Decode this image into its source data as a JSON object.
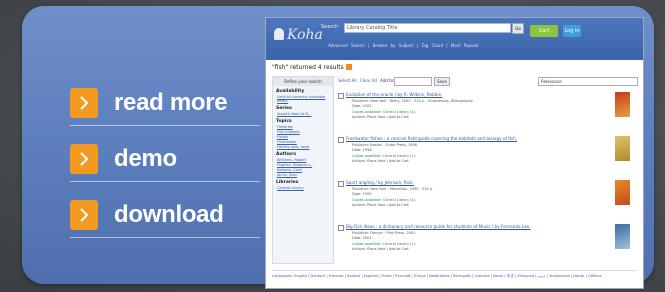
{
  "menu": {
    "items": [
      {
        "label": "read more"
      },
      {
        "label": "demo"
      },
      {
        "label": "download"
      }
    ]
  },
  "screenshot": {
    "logo": "Koha",
    "search_label": "Search",
    "search_value": "Library Catalog  Title",
    "go_label": "Go",
    "cart_label": "Cart",
    "login_label": "Log in",
    "top_links": "Advanced Search | Browse by Subject | Tag Cloud | Most Popular",
    "results_count": "\"fish\" returned 4 results",
    "facets": {
      "title": "Refine your search",
      "groups": [
        {
          "heading": "Availability",
          "links": [
            "Limit to currently available items."
          ]
        },
        {
          "heading": "Series",
          "links": [
            "Aquatic food of N..."
          ]
        },
        {
          "heading": "Topics",
          "links": [
            "Fisheries",
            "Fish habitats",
            "Fishes",
            "Freshwater",
            "Fishing rods, reels"
          ]
        },
        {
          "heading": "Authors",
          "links": [
            "Williams, Robert",
            "Hughes, Stephen L.",
            "Roberts, Colin",
            "Jarvis, Alan"
          ]
        },
        {
          "heading": "Libraries",
          "links": [
            "Central Library"
          ]
        }
      ]
    },
    "toolbar": {
      "select_all": "Select All",
      "clear_all": "Clear All",
      "add_to": "Add to:",
      "save": "Save",
      "sort": "Relevance"
    },
    "results": [
      {
        "title": "Evolution of the oracle / by R. Wilkins, Rebbie.",
        "line1": "Publisher: New York : Wiley, 2002 · 312 p. · Illustrations, Bibliography",
        "line2": "Date: 2002",
        "availability": "Copies available: Central Library (1).",
        "line3": "Actions:  Place Hold  |  Add to Cart"
      },
      {
        "title": "Freshwater fishes : a concise field guide covering the habitats and biology of fish.",
        "line1": "Publisher: Boston : Tudor Press, 1998",
        "line2": "Date: 1998",
        "availability": "Copies available: Central Library (1).",
        "line3": "Actions:  Place Hold  |  Add to Cart"
      },
      {
        "title": "Sport angling / by Johnson, Rick.",
        "line1": "Publisher: New York : Macmillan, 1995 · 214 p.",
        "line2": "Date: 1995",
        "availability": "Copies available: Central Library (1).",
        "line3": "Actions:  Place Hold  |  Add to Cart"
      },
      {
        "title": "Big Fish Ideas : a dictionary and resource guide for students of Music / by Fernando Lee.",
        "line1": "Publisher: Denver : Pilot Press, 2001",
        "line2": "Date: 2001",
        "availability": "Copies available: Central Library (1).",
        "line3": "Actions:  Place Hold  |  Add to Cart"
      }
    ],
    "footer": "Languages: English | Deutsch | Français | Italiano | Español | Polski | Русский | Türkçe | Nederlands | Português | Svenska | Norsk | 中文 | Ελληνικά | عربي | Українська | Dansk | Čeština"
  },
  "colors": {
    "panel": "#5f80bf",
    "accent": "#f39b20",
    "header": "#3a63a9",
    "link": "#2f5aa2"
  }
}
